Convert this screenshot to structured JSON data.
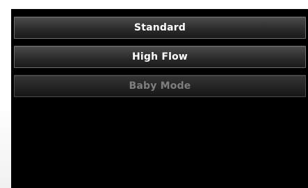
{
  "menu": {
    "items": [
      {
        "label": "Standard",
        "enabled": true
      },
      {
        "label": "High Flow",
        "enabled": true
      },
      {
        "label": "Baby Mode",
        "enabled": false
      }
    ]
  },
  "colors": {
    "screen_bg": "#000000",
    "button_text": "#ffffff",
    "disabled_text": "#7f7f7f",
    "button_border": "#6e6e6e"
  }
}
